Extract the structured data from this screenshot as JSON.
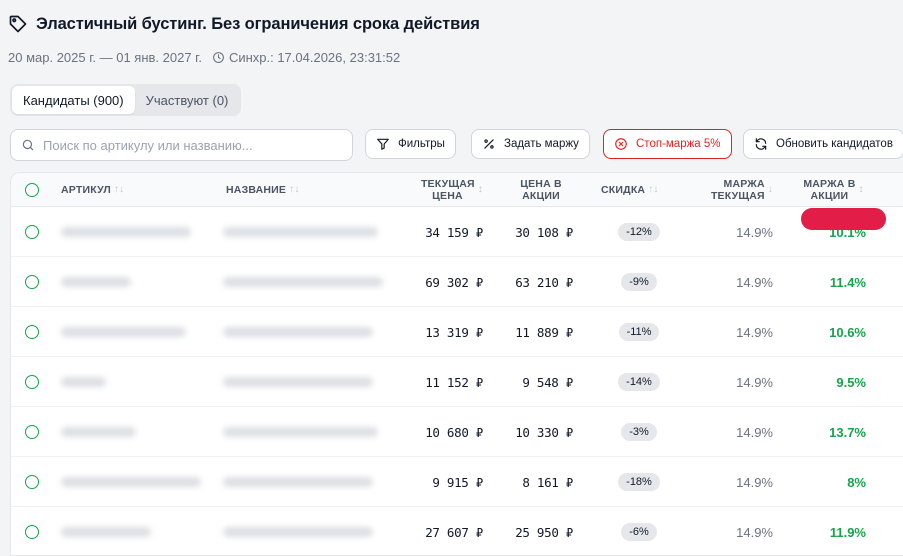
{
  "header": {
    "title": "Эластичный бустинг. Без ограничения срока действия",
    "period": "20 мар. 2025 г. — 01 янв. 2027 г.",
    "sync": "Синхр.: 17.04.2026, 23:31:52"
  },
  "tabs": [
    {
      "label": "Кандидаты (900)",
      "active": true
    },
    {
      "label": "Участвуют (0)",
      "active": false
    }
  ],
  "toolbar": {
    "search_placeholder": "Поиск по артикулу или названию...",
    "filters_label": "Фильтры",
    "set_margin_label": "Задать маржу",
    "stop_margin_label": "Стоп-маржа 5%",
    "refresh_label": "Обновить кандидатов"
  },
  "table": {
    "columns": {
      "article": "АРТИКУЛ",
      "name": "НАЗВАНИЕ",
      "current_price_1": "ТЕКУЩАЯ",
      "current_price_2": "ЦЕНА",
      "promo_price_1": "ЦЕНА В",
      "promo_price_2": "АКЦИИ",
      "discount": "СКИДКА",
      "margin_current_1": "МАРЖА",
      "margin_current_2": "ТЕКУЩАЯ",
      "margin_promo_1": "МАРЖА В",
      "margin_promo_2": "АКЦИИ"
    },
    "rows": [
      {
        "current_price": "34 159 ₽",
        "promo_price": "30 108 ₽",
        "discount": "-12%",
        "margin_current": "14.9%",
        "margin_promo": "10.1%"
      },
      {
        "current_price": "69 302 ₽",
        "promo_price": "63 210 ₽",
        "discount": "-9%",
        "margin_current": "14.9%",
        "margin_promo": "11.4%"
      },
      {
        "current_price": "13 319 ₽",
        "promo_price": "11 889 ₽",
        "discount": "-11%",
        "margin_current": "14.9%",
        "margin_promo": "10.6%"
      },
      {
        "current_price": "11 152 ₽",
        "promo_price": "9 548 ₽",
        "discount": "-14%",
        "margin_current": "14.9%",
        "margin_promo": "9.5%"
      },
      {
        "current_price": "10 680 ₽",
        "promo_price": "10 330 ₽",
        "discount": "-3%",
        "margin_current": "14.9%",
        "margin_promo": "13.7%"
      },
      {
        "current_price": "9 915 ₽",
        "promo_price": "8 161 ₽",
        "discount": "-18%",
        "margin_current": "14.9%",
        "margin_promo": "8%"
      },
      {
        "current_price": "27 607 ₽",
        "promo_price": "25 950 ₽",
        "discount": "-6%",
        "margin_current": "14.9%",
        "margin_promo": "11.9%"
      }
    ]
  },
  "icons": {
    "title": "tag-icon",
    "sync": "clock-icon",
    "search": "search-icon",
    "filters": "funnel-icon",
    "set_margin": "percent-icon",
    "stop_margin": "stop-circle-icon",
    "refresh": "refresh-icon"
  },
  "colors": {
    "accent_green": "#16a34a",
    "stop_red": "#dc2626",
    "redaction": "#e11d48"
  }
}
